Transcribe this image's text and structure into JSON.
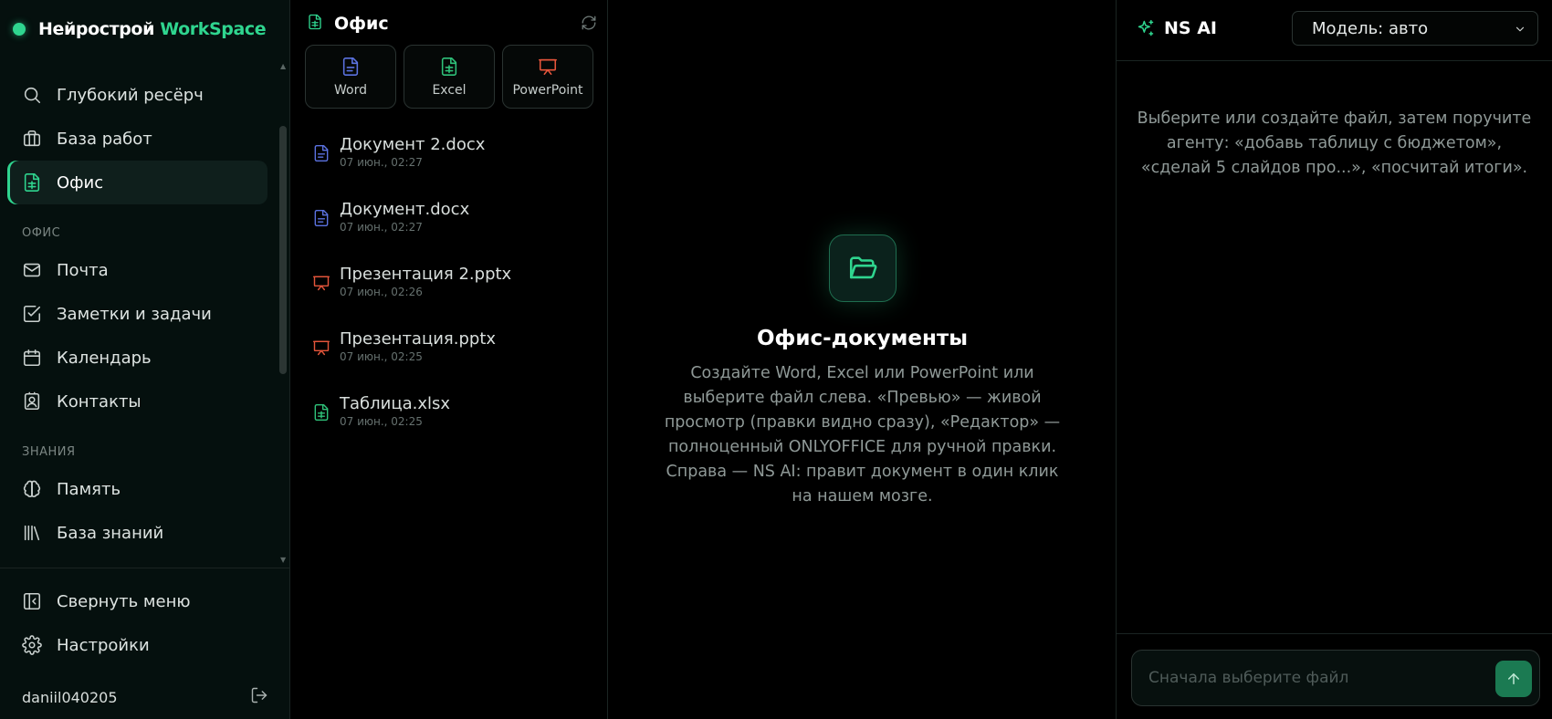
{
  "brand": {
    "name": "Нейрострой",
    "accent": "WorkSpace"
  },
  "sidebar": {
    "items": [
      {
        "label": "Глубокий ресёрч",
        "icon": "search-icon"
      },
      {
        "label": "База работ",
        "icon": "briefcase-icon"
      },
      {
        "label": "Офис",
        "icon": "spreadsheet-icon",
        "active": true
      },
      {
        "label": "Почта",
        "icon": "mail-icon"
      },
      {
        "label": "Заметки и задачи",
        "icon": "checkbox-icon"
      },
      {
        "label": "Календарь",
        "icon": "calendar-icon"
      },
      {
        "label": "Контакты",
        "icon": "contact-icon"
      },
      {
        "label": "Память",
        "icon": "brain-icon"
      },
      {
        "label": "База знаний",
        "icon": "library-icon"
      }
    ],
    "sections": {
      "office": "ОФИС",
      "knowledge": "ЗНАНИЯ"
    },
    "bottom": {
      "collapse": "Свернуть меню",
      "settings": "Настройки",
      "username": "daniil040205"
    }
  },
  "files_panel": {
    "title": "Офис",
    "create_buttons": [
      {
        "label": "Word",
        "icon": "word-doc-icon",
        "color": "#5b72e0"
      },
      {
        "label": "Excel",
        "icon": "excel-sheet-icon",
        "color": "#2fc27a"
      },
      {
        "label": "PowerPoint",
        "icon": "presentation-icon",
        "color": "#e5553b"
      }
    ],
    "files": [
      {
        "name": "Документ 2.docx",
        "date": "07 июн., 02:27",
        "type": "docx"
      },
      {
        "name": "Документ.docx",
        "date": "07 июн., 02:27",
        "type": "docx"
      },
      {
        "name": "Презентация 2.pptx",
        "date": "07 июн., 02:26",
        "type": "pptx"
      },
      {
        "name": "Презентация.pptx",
        "date": "07 июн., 02:25",
        "type": "pptx"
      },
      {
        "name": "Таблица.xlsx",
        "date": "07 июн., 02:25",
        "type": "xlsx"
      }
    ]
  },
  "center": {
    "title": "Офис-документы",
    "description": "Создайте Word, Excel или PowerPoint или выберите файл слева. «Превью» — живой просмотр (правки видно сразу), «Редактор» — полноценный ONLYOFFICE для ручной правки. Справа — NS AI: правит документ в один клик на нашем мозге."
  },
  "ai_panel": {
    "title": "NS AI",
    "model_label": "Модель: авто",
    "hint": "Выберите или создайте файл, затем поручите агенту: «добавь таблицу с бюджетом», «сделай 5 слайдов про...», «посчитай итоги».",
    "input_placeholder": "Сначала выберите файл"
  },
  "colors": {
    "accent": "#2fd58f",
    "word": "#5b72e0",
    "excel": "#2fc27a",
    "powerpoint": "#e5553b",
    "background": "#000000",
    "sidebar_bg": "#05100e"
  }
}
